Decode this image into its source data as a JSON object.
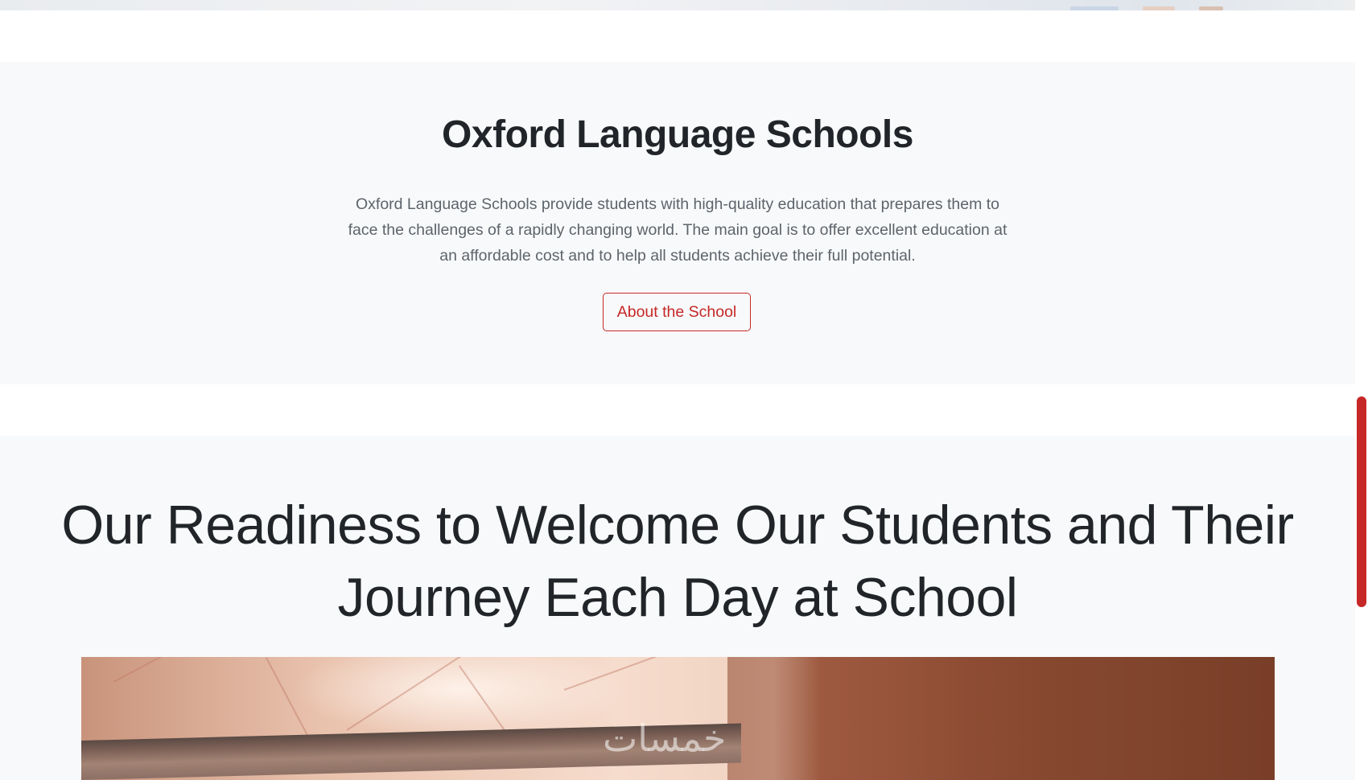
{
  "about": {
    "title": "Oxford Language Schools",
    "description": "Oxford Language Schools provide students with high-quality education that prepares them to face the challenges of a rapidly changing world. The main goal is to offer excellent education at an affordable cost and to help all students achieve their full potential.",
    "button_label": "About the School"
  },
  "readiness": {
    "title": "Our Readiness to Welcome Our Students and Their Journey Each Day at School"
  },
  "watermark": {
    "text": "خمسات"
  },
  "colors": {
    "accent": "#c62828",
    "section_bg": "#f8f9fa",
    "heading": "#212529",
    "body_text": "#5d646b"
  }
}
